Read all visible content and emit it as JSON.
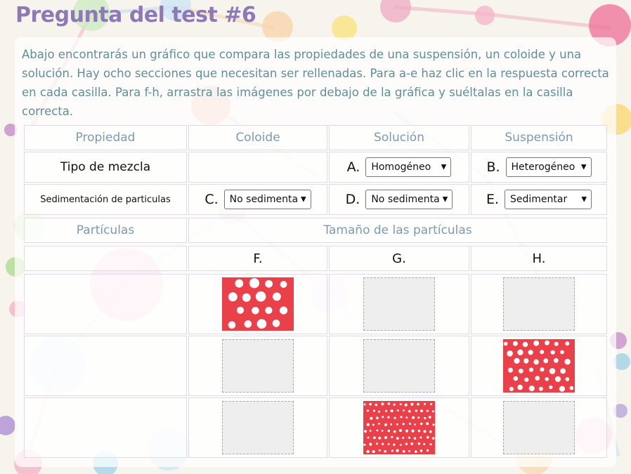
{
  "title": "Pregunta del test #6",
  "intro": "Abajo encontrarás un gráfico que compara las propiedades de una suspensión, un coloide y una solución. Hay ocho secciones que necesitan ser rellenadas. Para a-e haz clic en la respuesta correcta en cada casilla. Para f-h, arrastra las imágenes por debajo de la gráfica y suéltalas en la casilla correcta.",
  "table": {
    "headers": [
      "Propiedad",
      "Coloide",
      "Solución",
      "Suspensión"
    ],
    "row_mix": {
      "label": "Tipo de mezcla",
      "A": {
        "letter": "A.",
        "value": "Homogéneo"
      },
      "B": {
        "letter": "B.",
        "value": "Heterogéneo"
      }
    },
    "row_sed": {
      "label": "Sedimentación de particulas",
      "C": {
        "letter": "C.",
        "value": "No sedimenta"
      },
      "D": {
        "letter": "D.",
        "value": "No sedimenta"
      },
      "E": {
        "letter": "E.",
        "value": "Sedimentar"
      }
    },
    "particles_label": "Partículas",
    "size_label": "Tamaño de las partículas",
    "columns": [
      "F.",
      "G.",
      "H."
    ]
  },
  "particle_images": [
    {
      "name": "large-particles-image",
      "color": "#e9404a"
    },
    {
      "name": "medium-particles-image",
      "color": "#e9404a"
    },
    {
      "name": "small-particles-image",
      "color": "#e9404a"
    }
  ],
  "colors": {
    "title": "#8e79b8",
    "intro": "#5f8f9a",
    "header": "#7d99b3",
    "particle_fill": "#e9404a"
  }
}
